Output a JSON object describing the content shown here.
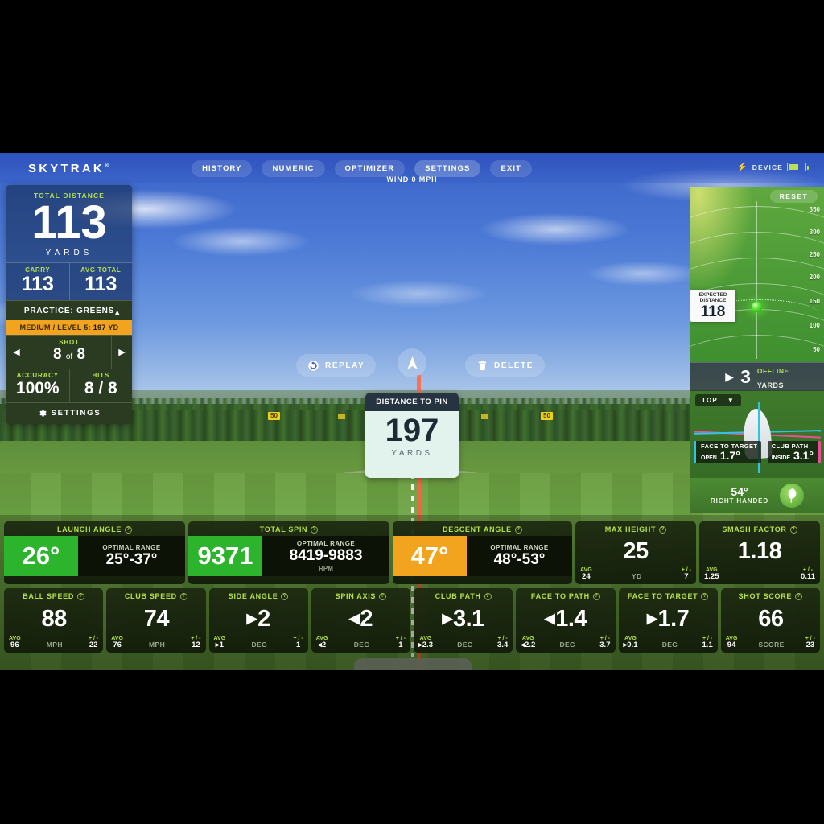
{
  "brand": {
    "name": "SKYTRAK",
    "tm": "®"
  },
  "nav": {
    "items": [
      {
        "label": "HISTORY",
        "active": false
      },
      {
        "label": "NUMERIC",
        "active": false
      },
      {
        "label": "OPTIMIZER",
        "active": false
      },
      {
        "label": "SETTINGS",
        "active": true
      },
      {
        "label": "EXIT",
        "active": false
      }
    ],
    "device_label": "DEVICE"
  },
  "scene": {
    "wind": "WIND 0 MPH",
    "replay_label": "REPLAY",
    "delete_label": "DELETE",
    "yard_markers": [
      "50",
      "50"
    ]
  },
  "distance_to_pin": {
    "title": "DISTANCE TO PIN",
    "value": "197",
    "unit": "YARDS"
  },
  "left_panel": {
    "total_distance_label": "TOTAL DISTANCE",
    "total_distance": "113",
    "unit": "YARDS",
    "carry_label": "CARRY",
    "carry": "113",
    "avg_total_label": "AVG TOTAL",
    "avg_total": "113",
    "practice_mode": "PRACTICE: GREENS",
    "level_prefix": "MEDIUM / LEVEL 5:",
    "level_distance": "197",
    "level_unit": "YD",
    "shot_label": "SHOT",
    "shot_current": "8",
    "shot_of": "of",
    "shot_total": "8",
    "accuracy_label": "ACCURACY",
    "accuracy": "100%",
    "hits_label": "HITS",
    "hits": "8 / 8",
    "settings_label": "SETTINGS"
  },
  "right_panel": {
    "reset_label": "RESET",
    "scale_ticks": [
      "350",
      "300",
      "250",
      "200",
      "150",
      "100",
      "50"
    ],
    "expected_label_line1": "EXPECTED",
    "expected_label_line2": "DISTANCE",
    "expected_value": "118",
    "offline_value": "3",
    "offline_label": "OFFLINE",
    "offline_unit": "YARDS",
    "view_select": "TOP",
    "face_to_target_label": "FACE TO TARGET",
    "face_to_target_prefix": "OPEN",
    "face_to_target_value": "1.7°",
    "club_path_label": "CLUB PATH",
    "club_path_prefix": "INSIDE",
    "club_path_value": "3.1°",
    "club_loft": "54°",
    "handedness": "RIGHT HANDED"
  },
  "stats": {
    "optimal_cards": [
      {
        "title": "LAUNCH ANGLE",
        "value": "26°",
        "state": "green",
        "range_label": "OPTIMAL RANGE",
        "range": "25°-37°",
        "range_unit": ""
      },
      {
        "title": "TOTAL SPIN",
        "value": "9371",
        "state": "green",
        "range_label": "OPTIMAL RANGE",
        "range": "8419-9883",
        "range_unit": "RPM"
      },
      {
        "title": "DESCENT ANGLE",
        "value": "47°",
        "state": "amber",
        "range_label": "OPTIMAL RANGE",
        "range": "48°-53°",
        "range_unit": ""
      }
    ],
    "row1_simple": [
      {
        "title": "MAX HEIGHT",
        "value": "25",
        "arrow": "",
        "avg_label": "AVG",
        "avg": "24",
        "unit": "YD",
        "pm_label": "+ / -",
        "pm": "7"
      },
      {
        "title": "SMASH FACTOR",
        "value": "1.18",
        "arrow": "",
        "avg_label": "AVG",
        "avg": "1.25",
        "unit": "",
        "pm_label": "+ / -",
        "pm": "0.11"
      }
    ],
    "row2": [
      {
        "title": "BALL SPEED",
        "value": "88",
        "arrow": "",
        "avg_label": "AVG",
        "avg": "96",
        "unit": "MPH",
        "pm_label": "+ / -",
        "pm": "22"
      },
      {
        "title": "CLUB SPEED",
        "value": "74",
        "arrow": "",
        "avg_label": "AVG",
        "avg": "76",
        "unit": "MPH",
        "pm_label": "+ / -",
        "pm": "12"
      },
      {
        "title": "SIDE ANGLE",
        "value": "2",
        "arrow": "▶",
        "avg_label": "AVG",
        "avg": "▸1",
        "unit": "DEG",
        "pm_label": "+ / -",
        "pm": "1"
      },
      {
        "title": "SPIN AXIS",
        "value": "2",
        "arrow": "◀",
        "avg_label": "AVG",
        "avg": "◂2",
        "unit": "DEG",
        "pm_label": "+ / -",
        "pm": "1"
      },
      {
        "title": "CLUB PATH",
        "value": "3.1",
        "arrow": "▶",
        "avg_label": "AVG",
        "avg": "▸2.3",
        "unit": "DEG",
        "pm_label": "+ / -",
        "pm": "3.4"
      },
      {
        "title": "FACE TO PATH",
        "value": "1.4",
        "arrow": "◀",
        "avg_label": "AVG",
        "avg": "◂2.2",
        "unit": "DEG",
        "pm_label": "+ / -",
        "pm": "3.7"
      },
      {
        "title": "FACE TO TARGET",
        "value": "1.7",
        "arrow": "▶",
        "avg_label": "AVG",
        "avg": "▸0.1",
        "unit": "DEG",
        "pm_label": "+ / -",
        "pm": "1.1"
      },
      {
        "title": "SHOT SCORE",
        "value": "66",
        "arrow": "",
        "avg_label": "AVG",
        "avg": "94",
        "unit": "SCORE",
        "pm_label": "+ / -",
        "pm": "23"
      }
    ]
  }
}
